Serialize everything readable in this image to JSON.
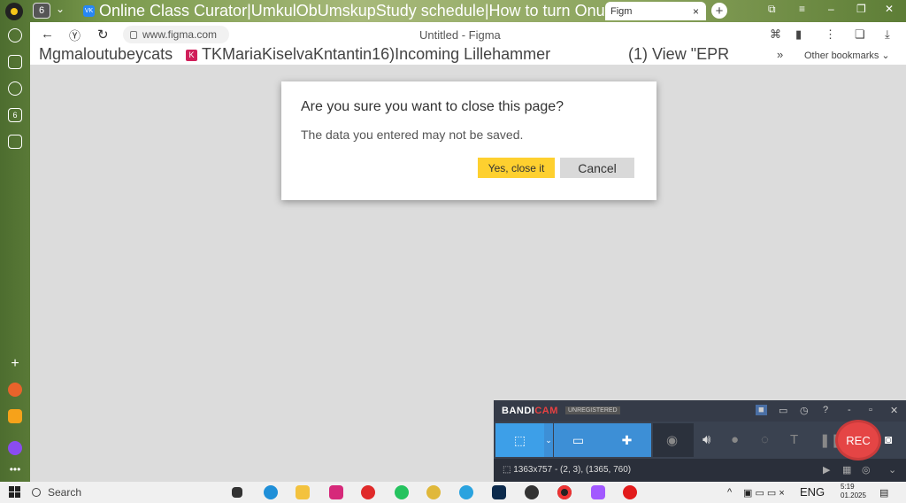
{
  "tabstrip": {
    "tab_count": "6",
    "tabs_text": "Online Class Curator|UmkulObUmskupStudy schedule|How to turn Onuntitled",
    "active_tab_label": "Figm",
    "active_tab_close": "×",
    "new_tab": "+"
  },
  "toolbar": {
    "url": "www.figma.com",
    "page_title": "Untitled - Figma"
  },
  "bookmarks": {
    "item1": "Mgmaloutubeycats",
    "item2": "TKMariaKiselvaKntantin16)Incoming Lillehammer",
    "item3": "(1) View \"EPR",
    "more": "»",
    "other": "Other bookmarks"
  },
  "dialog": {
    "title": "Are you sure you want to close this page?",
    "message": "The data you entered may not be saved.",
    "confirm_label": "Yes, close it",
    "cancel_label": "Cancel",
    "confirm_color": "#fed02f"
  },
  "bandicam": {
    "brand_a": "BANDI",
    "brand_b": "CAM",
    "status": "UNREGISTERED",
    "rec_label": "REC",
    "resolution": "1363x757 - (2, 3), (1365, 760)"
  },
  "taskbar": {
    "search_label": "Search",
    "language": "ENG",
    "time": "5:19",
    "date": "01.2025"
  }
}
